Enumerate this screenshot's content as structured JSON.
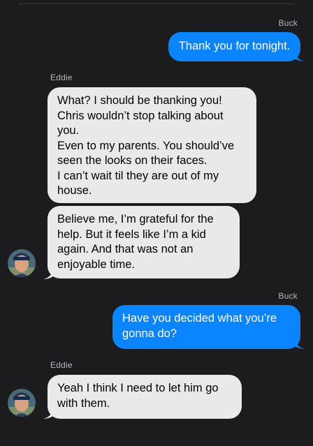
{
  "messages": [
    {
      "sender": "Buck",
      "text": "Thank you for tonight."
    },
    {
      "sender": "Eddie",
      "lines": [
        "What? I should be thanking you!",
        "Chris wouldn’t stop talking about",
        "you.",
        "Even to my parents. You should’ve",
        "seen the looks on their faces.",
        "I can’t wait til they are out of my",
        "house."
      ]
    },
    {
      "sender": "Eddie",
      "lines": [
        "Believe me, I’m grateful for the",
        "help. But it feels like I’m a kid",
        "again. And that was not an",
        "enjoyable time."
      ]
    },
    {
      "sender": "Buck",
      "lines": [
        "Have you decided what you’re",
        "gonna do?"
      ]
    },
    {
      "sender": "Eddie",
      "lines": [
        "Yeah I think I need to let him go",
        "with them."
      ]
    }
  ],
  "colors": {
    "background": "#1c1c1e",
    "outgoing_bubble": "#0a84ff",
    "incoming_bubble": "#e9e9eb",
    "sender_label": "#b7b7bc"
  },
  "icons": {
    "avatar": "contact-photo"
  }
}
